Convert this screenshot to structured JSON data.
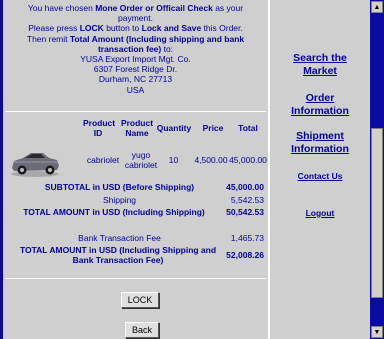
{
  "notice": {
    "l1a": "You have chosen ",
    "l1b": "Mone Order or Officail Check",
    "l1c": " as your",
    "l2": "payment.",
    "l3a": "Please press ",
    "l3b": "LOCK",
    "l3c": " button to ",
    "l3d": "Lock and Save",
    "l3e": " this Order.",
    "l4a": "Then remit ",
    "l4b": "Total Amount (Including shipping and bank",
    "l5a": "transaction fee)",
    "l5b": " to:",
    "addr": [
      "YUSA Export Import Mgt. Co.",
      "6307 Forest Ridge Dr.",
      "Durham, NC 27713",
      "USA"
    ]
  },
  "table": {
    "headers": {
      "product_id": "Product ID",
      "product_name": "Product Name",
      "quantity": "Quantity",
      "price": "Price",
      "total": "Total"
    },
    "rows": [
      {
        "product_id": "cabriolet",
        "product_name_1": "yugo",
        "product_name_2": "cabriolet",
        "quantity": "10",
        "price": "4,500.00",
        "total": "45,000.00"
      }
    ]
  },
  "summary": {
    "subtotal_label": "SUBTOTAL in USD (Before Shipping)",
    "subtotal_value": "45,000.00",
    "shipping_label": "Shipping",
    "shipping_value": "5,542.53",
    "total_label": "TOTAL AMOUNT in USD (Including Shipping)",
    "total_value": "50,542.53",
    "bank_fee_label": "Bank Transaction Fee",
    "bank_fee_value": "1,465.73",
    "grand_label_1": "TOTAL AMOUNT in USD (Including Shipping and",
    "grand_label_2": "Bank Transaction Fee)",
    "grand_value": "52,008.26"
  },
  "buttons": {
    "lock": "LOCK",
    "back": "Back"
  },
  "sidebar": {
    "search_1": "Search the",
    "search_2": "Market",
    "order_1": "Order",
    "order_2": "Information",
    "ship_1": "Shipment",
    "ship_2": "Information",
    "contact": "Contact Us",
    "logout": "Logout"
  },
  "scrollbar": {
    "up_icon": "arrow-up",
    "down_icon": "arrow-down"
  },
  "colors": {
    "text": "#0000a0",
    "frame": "#0a0a9e",
    "panel": "#cfcfcf"
  }
}
